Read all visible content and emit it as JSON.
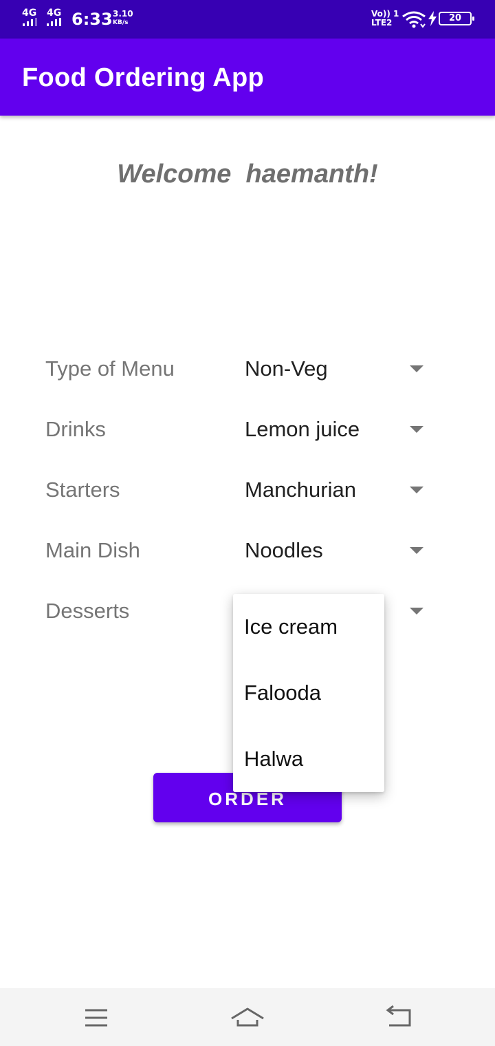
{
  "status_bar": {
    "net1": "4G",
    "net2": "4G",
    "time": "6:33",
    "speed_value": "3.10",
    "speed_unit": "KB/s",
    "volte_top": "Vo)) 1",
    "volte_bottom": "LTE2",
    "battery": "20"
  },
  "app_bar": {
    "title": "Food Ordering App"
  },
  "welcome": "Welcome  haemanth!",
  "form": {
    "rows": [
      {
        "label": "Type of Menu",
        "value": "Non-Veg"
      },
      {
        "label": "Drinks",
        "value": "Lemon juice"
      },
      {
        "label": "Starters",
        "value": "Manchurian"
      },
      {
        "label": "Main Dish",
        "value": "Noodles"
      },
      {
        "label": "Desserts",
        "value": ""
      }
    ]
  },
  "dropdown": {
    "options": [
      "Ice cream",
      "Falooda",
      "Halwa"
    ]
  },
  "order_button": {
    "label": "ORDER"
  },
  "colors": {
    "status_bar": "#3700b3",
    "primary": "#6200ee",
    "label": "#757575",
    "value": "#212121"
  },
  "nav_bar": {
    "icons": [
      "menu-icon",
      "home-icon",
      "back-icon"
    ]
  }
}
